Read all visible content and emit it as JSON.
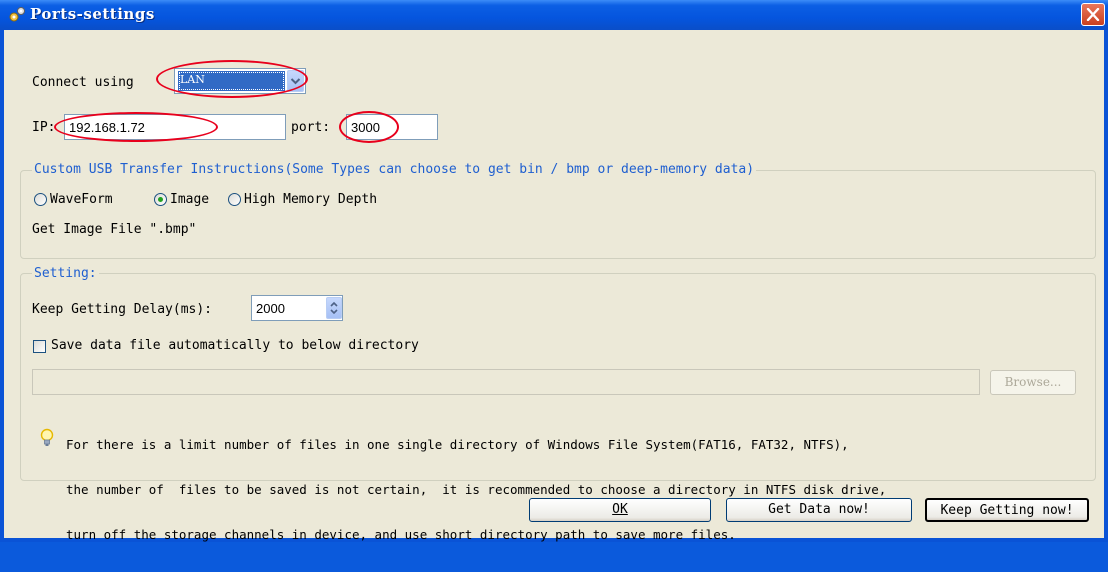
{
  "window": {
    "title": "Ports-settings",
    "close_icon": "close-icon"
  },
  "connection": {
    "connect_label": "Connect using",
    "connect_value": "LAN",
    "ip_label": "IP:",
    "ip_value": "192.168.1.72",
    "port_label": "port:",
    "port_value": "3000"
  },
  "usb_group": {
    "title": "Custom USB Transfer Instructions(Some Types can choose to get bin / bmp or deep-memory data)",
    "options": [
      "WaveForm",
      "Image",
      "High Memory Depth"
    ],
    "selected": "Image",
    "info": "Get Image File \".bmp\""
  },
  "setting_group": {
    "title": "Setting:",
    "delay_label": "Keep Getting Delay(ms):",
    "delay_value": "2000",
    "save_checkbox_label": "Save data file automatically to below directory",
    "save_checked": false,
    "directory_value": "",
    "browse_label": "Browse...",
    "note_icon": "lightbulb-icon",
    "note_lines": [
      "For there is a limit number of files in one single directory of Windows File System(FAT16, FAT32, NTFS),",
      "the number of  files to be saved is not certain,  it is recommended to choose a directory in NTFS disk drive,",
      "turn off the storage channels in device, and use short directory path to save more files."
    ]
  },
  "buttons": {
    "ok": "OK",
    "get_data": "Get Data now!",
    "keep_getting": "Keep Getting now!"
  },
  "colors": {
    "titlebar": "#0555de",
    "client_bg": "#ece9d8",
    "annotation_ring": "#e8001c",
    "group_title": "#1f5fd0"
  }
}
